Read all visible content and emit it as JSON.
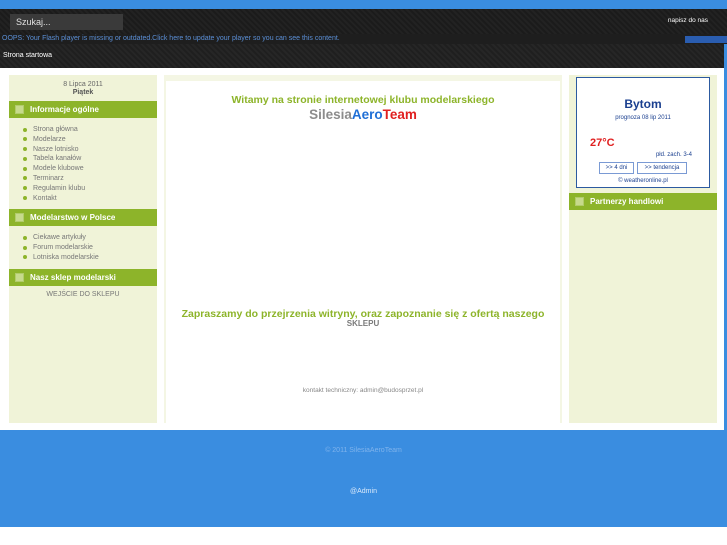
{
  "topbar": {
    "search_placeholder": "Szukaj...",
    "contact_link": "napisz do nas"
  },
  "flash_message": "OOPS: Your Flash player is missing or outdated.Click here to update your player so you can see this content.",
  "nav": {
    "home": "Strona startowa"
  },
  "left": {
    "date": "8 Lipca 2011",
    "weekday": "Piątek",
    "sections": [
      {
        "title": "Informacje ogólne",
        "items": [
          "Strona główna",
          "Modelarze",
          "Nasze lotnisko",
          "Tabela kanałów",
          "Modele klubowe",
          "Terminarz",
          "Regulamin klubu",
          "Kontakt"
        ]
      },
      {
        "title": "Modelarstwo w Polsce",
        "items": [
          "Ciekawe artykuły",
          "Forum modelarskie",
          "Lotniska modelarskie"
        ]
      },
      {
        "title": "Nasz sklep modelarski",
        "link": "WEJŚCIE DO SKLEPU"
      }
    ]
  },
  "main": {
    "welcome": "Witamy na stronie internetowej klubu modelarskiego",
    "brand": {
      "part1": "Silesia",
      "part2": "Aero",
      "part3": "Team"
    },
    "invite": "Zapraszamy do przejrzenia witryny, oraz zapoznanie się z ofertą naszego",
    "invite_shop": "SKLEPU",
    "tech_contact": "kontakt techniczny: admin@budosprzet.pl"
  },
  "weather": {
    "city": "Bytom",
    "forecast_date": "prognoza 08 lip 2011",
    "temperature": "27°C",
    "wind": "płd. zach. 3-4",
    "btn_4days": ">> 4 dni",
    "btn_trend": ">> tendencja",
    "source": "© weatheronline.pl"
  },
  "right": {
    "partners_title": "Partnerzy handlowi"
  },
  "footer": {
    "copyright": "© 2011 SilesiaAeroTeam",
    "admin": "@Admin"
  },
  "colors": {
    "accent_green": "#8db42a",
    "page_blue": "#3a8de0",
    "brand_blue": "#1f6fd6",
    "brand_red": "#e02020",
    "weather_navy": "#1a3f8f"
  }
}
